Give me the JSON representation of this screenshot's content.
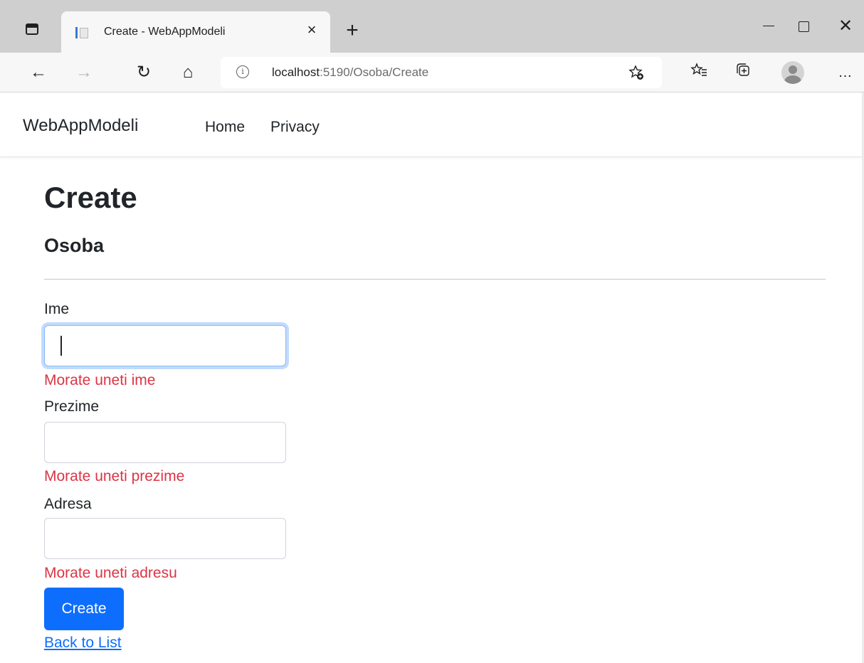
{
  "browser": {
    "tab": {
      "title": "Create - WebAppModeli",
      "close": "×"
    },
    "new_tab": "+",
    "window": {
      "close": "✕"
    },
    "nav": {
      "back": "←",
      "forward": "→",
      "refresh": "↻",
      "home": "⌂"
    },
    "address": {
      "host": "localhost",
      "path": ":5190/Osoba/Create",
      "info": "i"
    },
    "icons": {
      "tab_strip": "tab-strip-icon",
      "favorite_add": "star-plus-icon",
      "favorites": "favorites-list-icon",
      "collections": "collections-icon",
      "profile": "profile-avatar-icon",
      "more": "…"
    }
  },
  "site": {
    "brand": "WebAppModeli",
    "nav": [
      {
        "label": "Home"
      },
      {
        "label": "Privacy"
      }
    ]
  },
  "page": {
    "title": "Create",
    "subtitle": "Osoba",
    "fields": [
      {
        "label": "Ime",
        "value": "",
        "error": "Morate uneti ime",
        "focused": true
      },
      {
        "label": "Prezime",
        "value": "",
        "error": "Morate uneti prezime",
        "focused": false
      },
      {
        "label": "Adresa",
        "value": "",
        "error": "Morate uneti adresu",
        "focused": false
      }
    ],
    "submit_label": "Create",
    "back_link": "Back to List"
  },
  "colors": {
    "primary": "#0d6efd",
    "error": "#dc3545",
    "text": "#212529",
    "focus_ring": "#86b7fe"
  }
}
